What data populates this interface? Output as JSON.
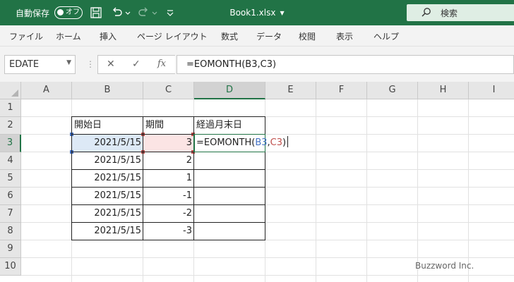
{
  "titlebar": {
    "autosave_label": "自動保存",
    "autosave_state": "オフ",
    "doc_title": "Book1.xlsx",
    "search_label": "検索",
    "bg_color": "#217346"
  },
  "ribbon": {
    "tabs": [
      "ファイル",
      "ホーム",
      "挿入",
      "ページ レイアウト",
      "数式",
      "データ",
      "校閲",
      "表示",
      "ヘルプ"
    ]
  },
  "formula_bar": {
    "name_box": "EDATE",
    "cancel_label": "✕",
    "enter_label": "✓",
    "fx_label": "fx",
    "formula": "=EOMONTH(B3,C3)"
  },
  "sheet": {
    "columns": [
      "A",
      "B",
      "C",
      "D",
      "E",
      "F",
      "G",
      "H",
      "I"
    ],
    "rows": [
      "1",
      "2",
      "3",
      "4",
      "5",
      "6",
      "7",
      "8",
      "9",
      "10"
    ],
    "active_column": "D",
    "active_row": "3",
    "headers": {
      "b": "開始日",
      "c": "期間",
      "d": "経過月末日"
    },
    "data": [
      {
        "start": "2021/5/15",
        "period": "3"
      },
      {
        "start": "2021/5/15",
        "period": "2"
      },
      {
        "start": "2021/5/15",
        "period": "1"
      },
      {
        "start": "2021/5/15",
        "period": "-1"
      },
      {
        "start": "2021/5/15",
        "period": "-2"
      },
      {
        "start": "2021/5/15",
        "period": "-3"
      }
    ],
    "edit_prefix": "=EOMONTH(",
    "edit_ref1": "B3",
    "edit_comma": ",",
    "edit_ref2": "C3",
    "edit_suffix": ")",
    "ref1_color": "#4472c4",
    "ref2_color": "#c0504d",
    "accent_color": "#217346"
  },
  "watermark": "Buzzword Inc."
}
